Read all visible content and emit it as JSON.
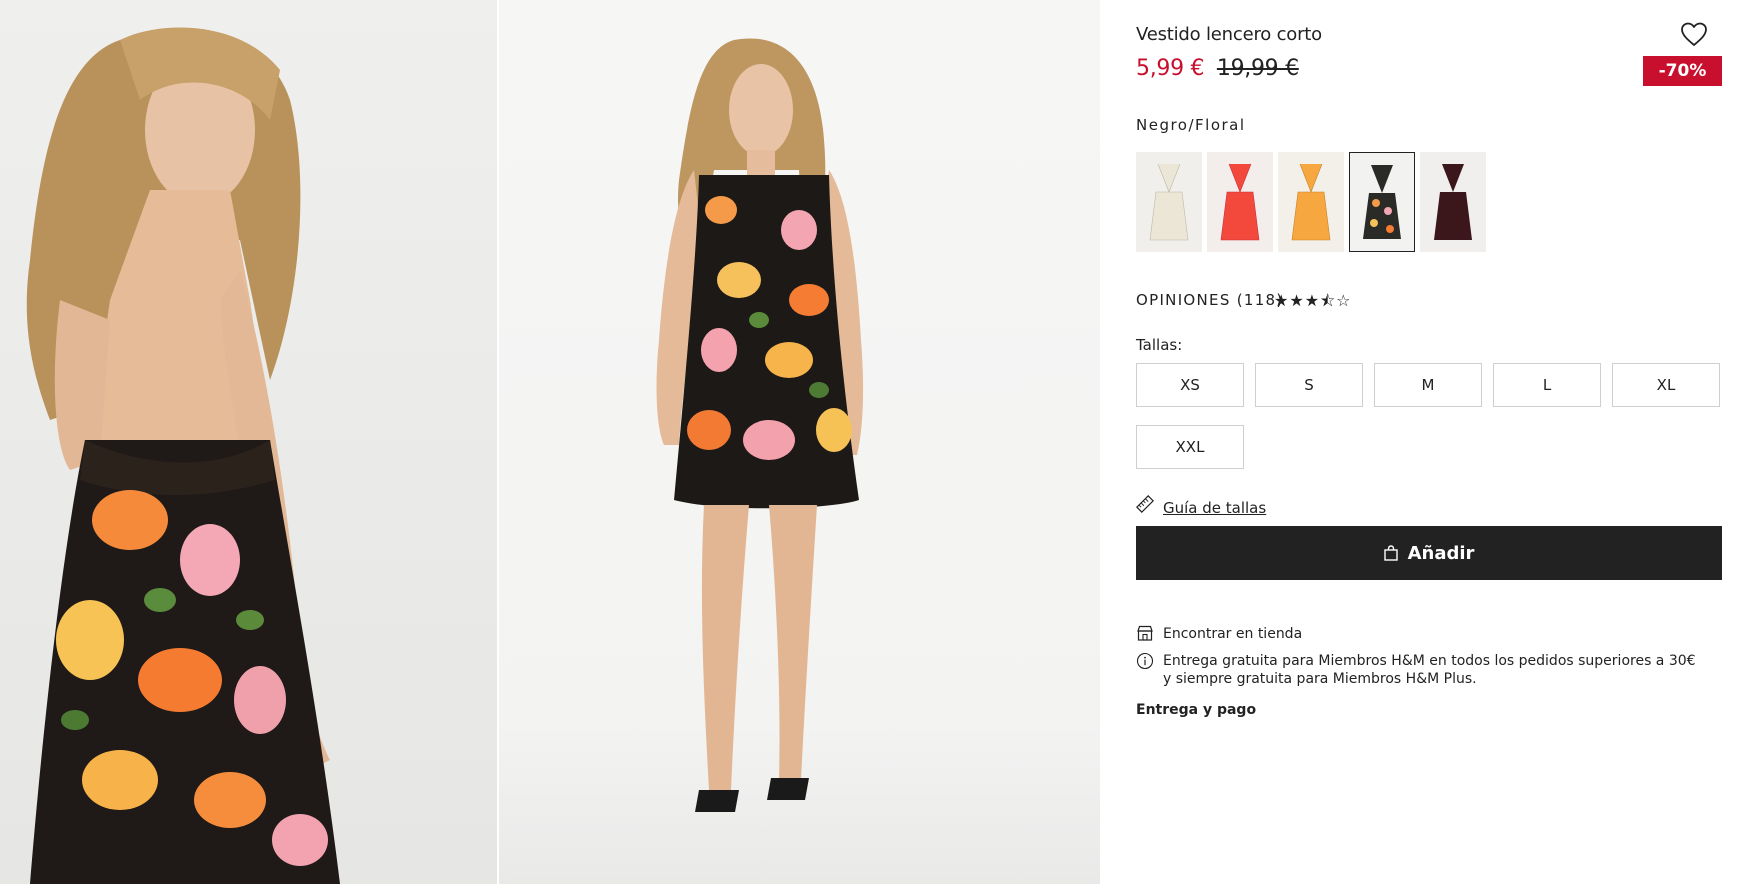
{
  "product": {
    "title": "Vestido lencero corto",
    "price_sale": "5,99 €",
    "price_old": "19,99 €",
    "discount_badge": "-70%",
    "color_name": "Negro/Floral"
  },
  "swatches": [
    {
      "name": "cream",
      "color": "#ece6d6",
      "bg": "#f1efec",
      "selected": false
    },
    {
      "name": "red",
      "color": "#f2493c",
      "bg": "#f3eeec",
      "selected": false
    },
    {
      "name": "orange",
      "color": "#f7a740",
      "bg": "#f3efe9",
      "selected": false
    },
    {
      "name": "black-floral",
      "color": "#2a2a26",
      "bg": "#f2f2f1",
      "selected": true
    },
    {
      "name": "burgundy",
      "color": "#3b161b",
      "bg": "#f0efee",
      "selected": false
    }
  ],
  "reviews": {
    "label": "OPINIONES (118)",
    "rating_stars": "★★★⯪☆",
    "rating": 3.5
  },
  "sizes": {
    "label": "Tallas:",
    "options": [
      "XS",
      "S",
      "M",
      "L",
      "XL",
      "XXL"
    ]
  },
  "size_guide": {
    "label": "Guía de tallas",
    "icon": "ruler-icon"
  },
  "add_button": {
    "label": "Añadir",
    "icon": "shopping-bag-icon"
  },
  "store": {
    "label": "Encontrar en tienda",
    "icon": "store-icon"
  },
  "shipping_info": {
    "text": "Entrega gratuita para Miembros H&M en todos los pedidos superiores a 30€ y siempre gratuita para Miembros H&M Plus.",
    "icon": "info-icon"
  },
  "delivery_link": "Entrega y pago",
  "colors": {
    "sale_red": "#c8102e",
    "button_dark": "#222222",
    "text": "#222222"
  }
}
